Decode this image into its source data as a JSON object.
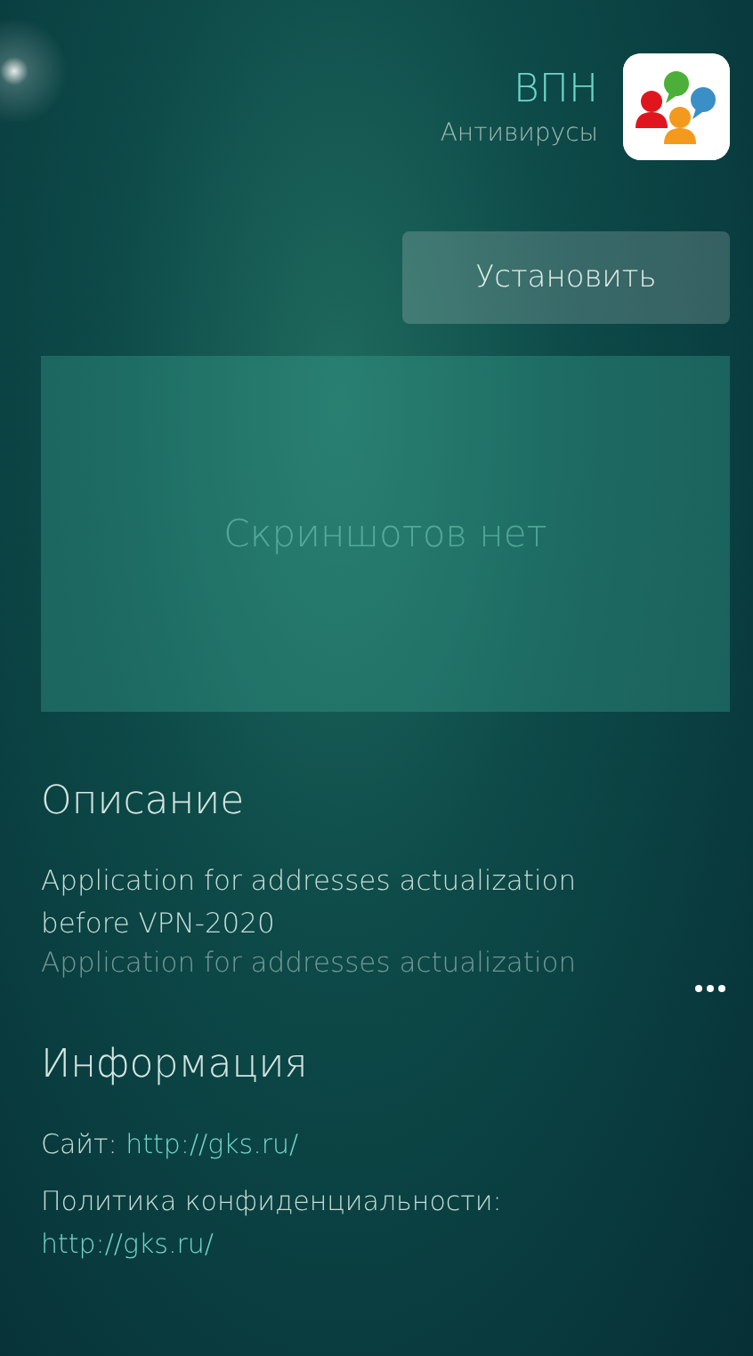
{
  "app": {
    "title": "ВПН",
    "category": "Антивирусы"
  },
  "install_button": "Установить",
  "screenshots": {
    "placeholder": "Скриншотов нет"
  },
  "description": {
    "heading": "Описание",
    "text": "Application for addresses actualization before VPN-2020",
    "faded_line": "Application for addresses actualization"
  },
  "info": {
    "heading": "Информация",
    "site_label": "Сайт:",
    "site_link": "http://gks.ru/",
    "policy_label": "Политика конфиденциальности:",
    "policy_link": "http://gks.ru/"
  }
}
